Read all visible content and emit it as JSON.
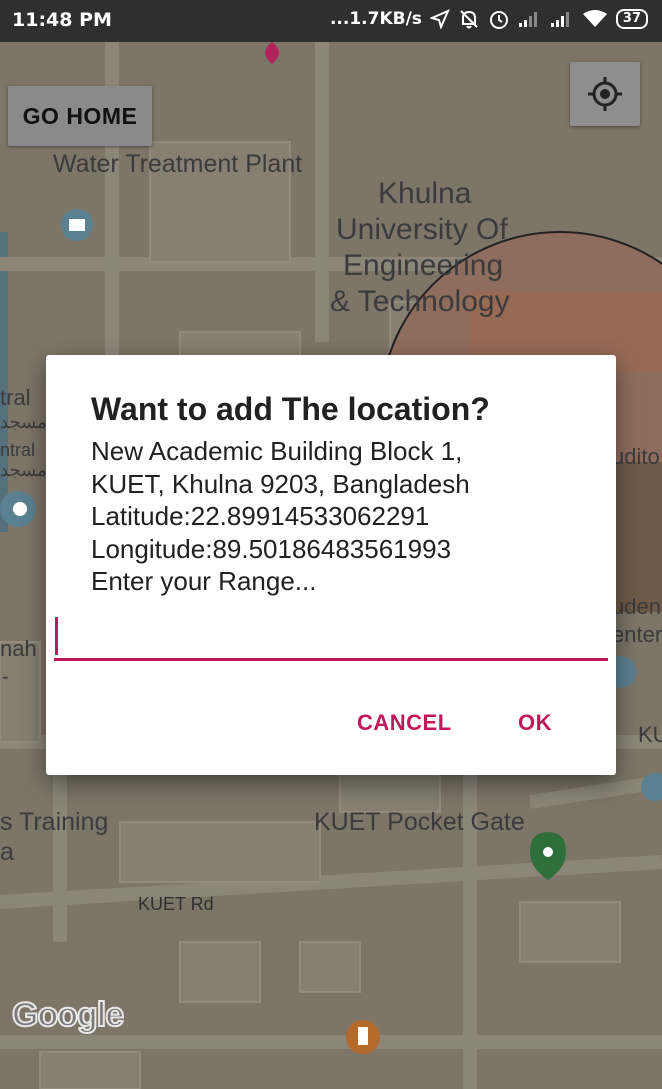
{
  "status_bar": {
    "time": "11:48 PM",
    "net_speed": "...1.7KB/s",
    "battery": "37"
  },
  "map": {
    "go_home_label": "GO HOME",
    "labels": {
      "water_treatment": "Water Treatment Plant",
      "kuet_line1": "Khulna",
      "kuet_line2": "University Of",
      "kuet_line3": "Engineering",
      "kuet_line4": "& Technology",
      "tral": "tral",
      "tral_ar": "مسجد",
      "ntral": "ntral",
      "ntral_ar": "مسجد",
      "nah": "nah",
      "dash": "-",
      "udito": "udito",
      "uden": "uden",
      "enter": "enter",
      "ku": "KU",
      "training": "s Training",
      "training_a": "a",
      "pocket_gate": "KUET Pocket Gate",
      "kuet_rd": "KUET Rd"
    },
    "google_logo": "Google"
  },
  "dialog": {
    "title": "Want to add The location?",
    "address_line1": "New Academic Building Block 1,",
    "address_line2": "KUET, Khulna 9203, Bangladesh",
    "latitude": "Latitude:22.89914533062291",
    "longitude": "Longitude:89.50186483561993",
    "prompt": "Enter your Range...",
    "input_value": "",
    "cancel_label": "CANCEL",
    "ok_label": "OK"
  },
  "colors": {
    "accent": "#c2185b",
    "map_bg": "#7c7468",
    "dialog_bg": "#ffffff"
  }
}
